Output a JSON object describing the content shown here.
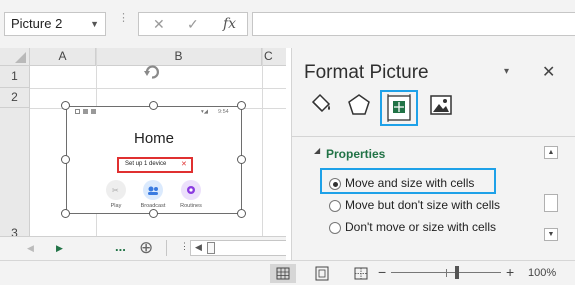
{
  "formula_bar": {
    "name_box": "Picture 2",
    "cancel_glyph": "✕",
    "enter_glyph": "✓",
    "fx_glyph": "fx",
    "formula_value": ""
  },
  "sheet": {
    "columns": [
      "A",
      "B",
      "C"
    ],
    "rows": [
      "1",
      "2",
      "3"
    ]
  },
  "picture": {
    "status_time": "9:54",
    "title": "Home",
    "setup_label": "Set up 1 device",
    "setup_close": "✕",
    "apps": [
      {
        "label": "Play",
        "color": "#eeeeee"
      },
      {
        "label": "Broadcast",
        "color": "#dbeafd"
      },
      {
        "label": "Routines",
        "color": "#ece0fb"
      }
    ]
  },
  "tab_bar": {
    "more_label": "...",
    "add_symbol": "⊕"
  },
  "format_panel": {
    "title": "Format Picture",
    "close_glyph": "✕",
    "dropdown_glyph": "▾",
    "tools": [
      "fill-line-icon",
      "effects-icon",
      "size-properties-icon",
      "picture-icon"
    ],
    "section": {
      "heading": "Properties",
      "options": [
        {
          "label": "Move and size with cells",
          "selected": true
        },
        {
          "label": "Move but don't size with cells",
          "selected": false
        },
        {
          "label": "Don't move or size with cells",
          "selected": false
        }
      ]
    }
  },
  "status_bar": {
    "zoom_minus": "−",
    "zoom_plus": "+",
    "zoom": "100%",
    "zoom_level": 100
  },
  "colors": {
    "accent_highlight": "#1ea1e8",
    "excel_green": "#217346",
    "setup_red": "#e03030"
  }
}
